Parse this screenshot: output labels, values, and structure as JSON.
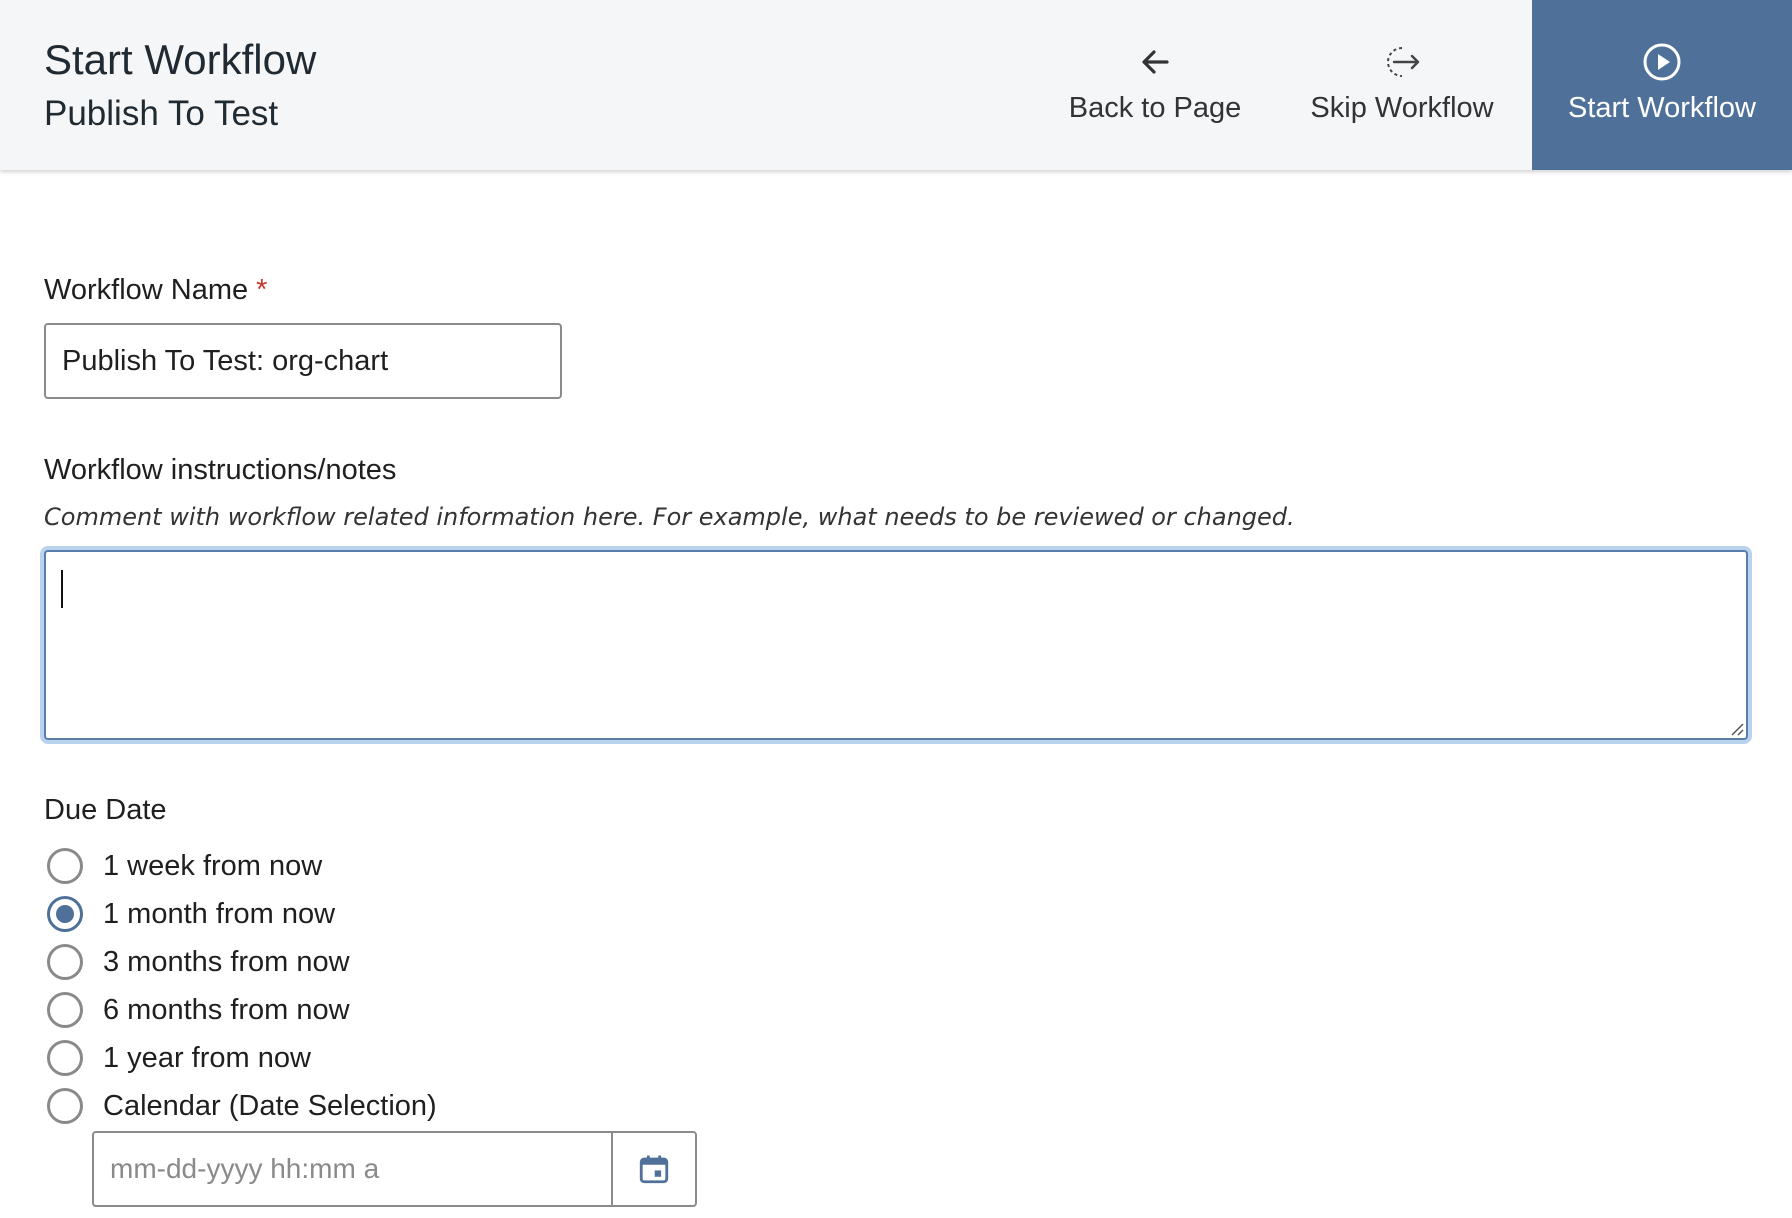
{
  "header": {
    "title": "Start Workflow",
    "subtitle": "Publish To Test",
    "actions": {
      "back": {
        "label": "Back to Page",
        "icon": "arrow-left-icon"
      },
      "skip": {
        "label": "Skip Workflow",
        "icon": "skip-arrow-icon"
      },
      "start": {
        "label": "Start Workflow",
        "icon": "play-circle-icon"
      }
    }
  },
  "colors": {
    "accent": "#4f7199",
    "required": "#c0392b",
    "focus_ring": "#b9d3ef"
  },
  "form": {
    "workflow_name": {
      "label": "Workflow Name",
      "required_marker": "*",
      "value": "Publish To Test: org-chart"
    },
    "notes": {
      "label": "Workflow instructions/notes",
      "hint": "Comment with workflow related information here. For example, what needs to be reviewed or changed.",
      "value": ""
    },
    "due_date": {
      "label": "Due Date",
      "options": [
        {
          "label": "1 week from now",
          "checked": false
        },
        {
          "label": "1 month from now",
          "checked": true
        },
        {
          "label": "3 months from now",
          "checked": false
        },
        {
          "label": "6 months from now",
          "checked": false
        },
        {
          "label": "1 year from now",
          "checked": false
        },
        {
          "label": "Calendar (Date Selection)",
          "checked": false
        }
      ],
      "date_input": {
        "placeholder": "mm-dd-yyyy hh:mm a",
        "value": "",
        "calendar_icon": "calendar-icon"
      }
    }
  }
}
